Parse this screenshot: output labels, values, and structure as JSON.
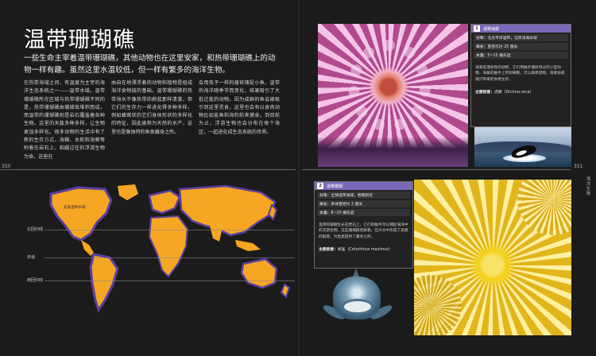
{
  "left_page": {
    "title": "温带珊瑚礁",
    "intro": "一些生命主宰着温带珊瑚礁，其他动物也在这里安家，和热带珊瑚礁上的动物一样有趣。虽然这里水温较低，但一样有繁多的海洋生物。",
    "columns": [
      "在热带海域之间，有温度为主宰的海洋生态系统之一——温带水域。温带珊瑚礁所在区域与热带珊瑚礁不同的是，热带珊瑚礁由珊瑚虫堆积而成，而温带的珊瑚礁则是岩石覆盖着各种生物。这里的天敌多种多样，让生物更加多样化。很多动物的生活中有了新的生存方式，海鞘、水蛇和海葵等附着在岩石上，蹈踞过往的浮游生物为食。这些在",
      "由自在地漂浮着的动物和植物是组成海洋食物链的基础。温带珊瑚礁的热带海水不像热带的蔚蓝那样清澈，但它们的生存力一样进化得多种多样，例如蜂窝状的它们身体形状的多样化的特征，因此被称为天然的水产，这里也是像独特的鱼类藏身之所。",
      "会用虫子一样的器官捕捉小鱼。温带的海洋随季节而变化，结果吸引了大批迁徙的动物。因为成群的鱼会被吸引到这里觅食，这里也会有以食肉动物比如鲨鱼和海豹前来捕食。到目前为止，浮游生物也会分布在每个海区，一起进化成生态系统的世界。"
    ],
    "page_number": "350",
    "map": {
      "latitude_labels": [
        "北回归线",
        "赤道",
        "南回归线"
      ],
      "region_label": "北美温带水域"
    }
  },
  "right_page": {
    "page_number": "351",
    "side_tab": "海洋生物",
    "card1": {
      "number": "1",
      "name": "温带海葵",
      "rows": [
        {
          "key": "分布：",
          "value": "北太平洋温带，沿岸浅海水域"
        },
        {
          "key": "体长：",
          "value": "直径可达 25 厘米"
        },
        {
          "key": "水温：",
          "value": "5~15 摄氏度"
        }
      ],
      "description": "海葵是捕食性的动物，它们用触手捕捉经过的小型动物，海葵的触手上有刺细胞，可以麻痹猎物，海葵依靠潮汐带来的食物生存。",
      "enemy_key": "主要敌害：",
      "enemy_value": "虎鲸（Orcinus orca）"
    },
    "card2": {
      "number": "2",
      "name": "温带珊瑚",
      "rows": [
        {
          "key": "分布：",
          "value": "全球温带海域，岩礁附近"
        },
        {
          "key": "体长：",
          "value": "单体直径约 2 厘米"
        },
        {
          "key": "水温：",
          "value": "8~20 摄氏度"
        }
      ],
      "description": "温带的珊瑚生长在岩石上，它们的触手可以捕捉海洋中的浮游生物。这些珊瑚颜色鲜艳，在冷水中形成了美丽的群落，为鱼类提供了藏身之所。",
      "enemy_key": "主要敌害：",
      "enemy_value": "姥鲨（Cetorhinus maximus）"
    }
  },
  "colors": {
    "land": "#f5a623",
    "coast_highlight": "#5a3fa0",
    "card_header": "#7b68b8"
  }
}
